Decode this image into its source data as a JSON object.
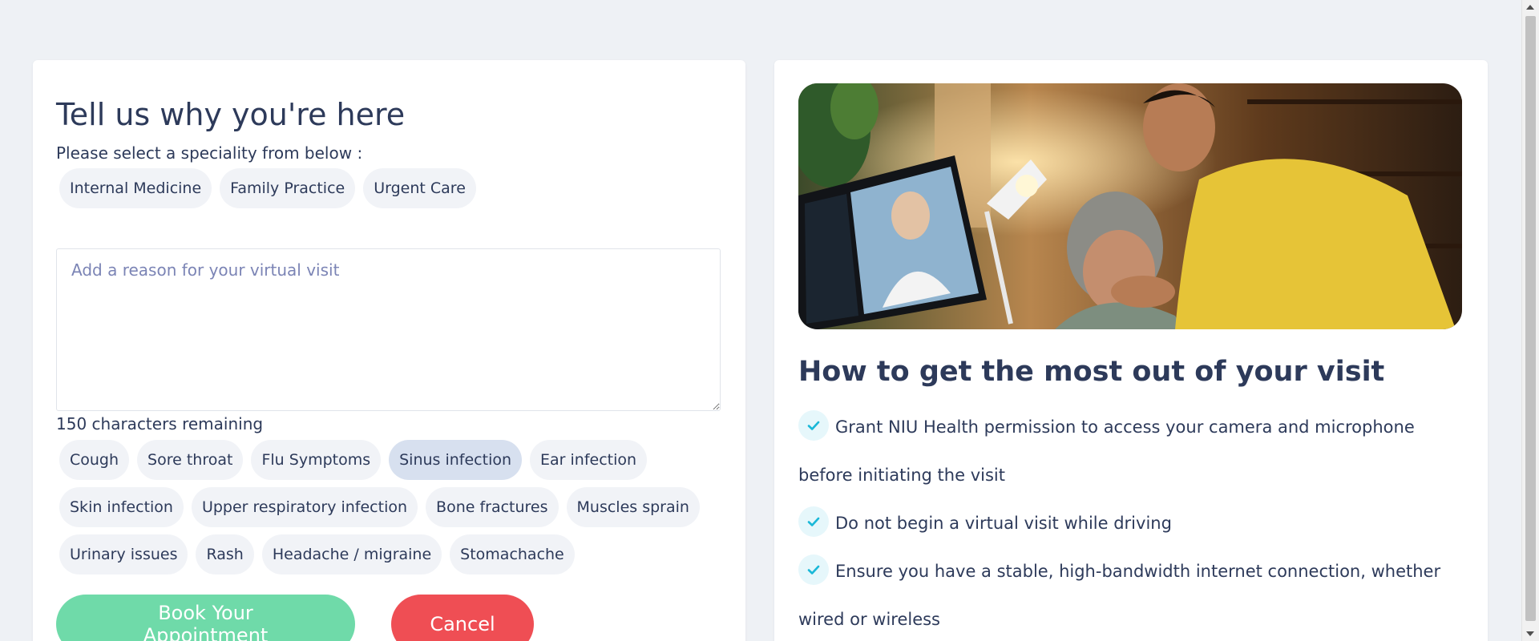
{
  "left_card": {
    "title": "Tell us why you're here",
    "specialty_prompt": "Please select a speciality from below :",
    "specialties": [
      "Internal Medicine",
      "Family Practice",
      "Urgent Care"
    ],
    "reason_placeholder": "Add a reason for your virtual visit",
    "reason_value": "",
    "chars_remaining": "150 characters remaining",
    "reasons": [
      "Cough",
      "Sore throat",
      "Flu Symptoms",
      "Sinus infection",
      "Ear infection",
      "Skin infection",
      "Upper respiratory infection",
      "Bone fractures",
      "Muscles sprain",
      "Urinary issues",
      "Rash",
      "Headache / migraine",
      "Stomachache"
    ],
    "selected_reason": "Sinus infection",
    "book_button": "Book Your Appointment",
    "cancel_button": "Cancel"
  },
  "right_card": {
    "title": "How to get the most out of your visit",
    "tips": [
      "Grant NIU Health permission to access your camera and microphone before initiating the visit",
      "Do not begin a virtual visit while driving",
      "Ensure you have a stable, high-bandwidth internet connection, whether wired or wireless"
    ],
    "check_icon": "check-icon"
  },
  "colors": {
    "page_bg": "#eef1f5",
    "card_bg": "#ffffff",
    "text": "#2d3a5a",
    "chip_bg": "#f1f3f7",
    "chip_selected_bg": "#d7e0ef",
    "placeholder": "#7b84b5",
    "book_button": "#6fdaa9",
    "cancel_button": "#ef4e54",
    "check": "#1ab8d8",
    "check_bg": "#e6f7fb"
  }
}
